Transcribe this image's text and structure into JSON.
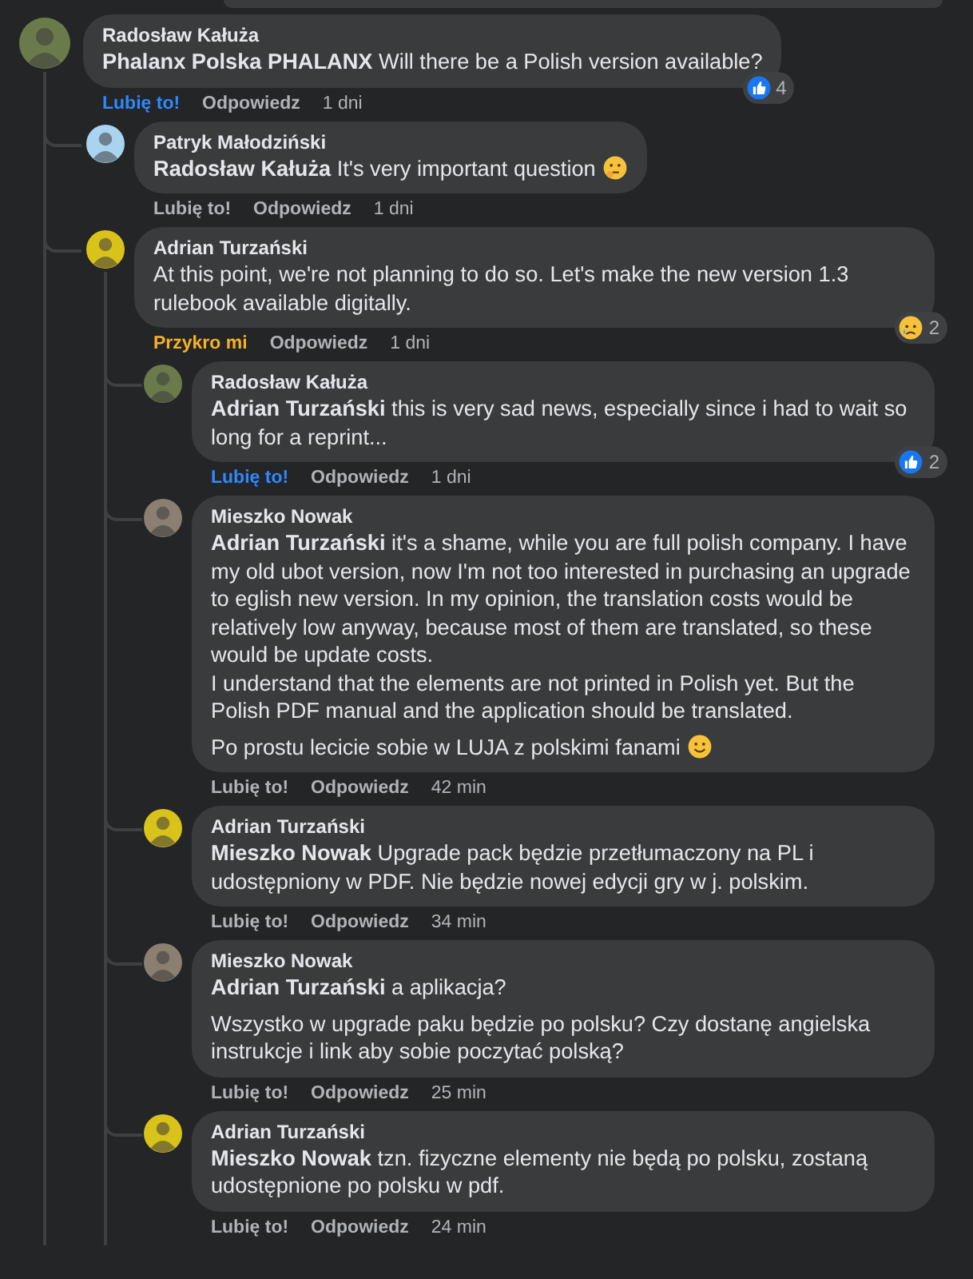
{
  "comments": [
    {
      "author": "Radosław Kałuża",
      "color": "#6b7a4a",
      "paragraphs": [
        {
          "text": "**Phalanx Polska PHALANX** Will there be a Polish version available?"
        }
      ],
      "reaction": {
        "kind": "like",
        "label": "Lubię to!"
      },
      "reply": "Odpowiedz",
      "time": "1 dni",
      "badge": {
        "kind": "like",
        "count": "4"
      },
      "children": [
        {
          "author": "Patryk Małodziński",
          "color": "#a9d4f0",
          "paragraphs": [
            {
              "text": "**Radosław Kałuża** It's very important question",
              "trailing_icon": {
                "kind": "thinking"
              }
            }
          ],
          "reaction": {
            "kind": "none",
            "label": "Lubię to!"
          },
          "reply": "Odpowiedz",
          "time": "1 dni"
        },
        {
          "author": "Adrian Turzański",
          "color": "#d9c21a",
          "paragraphs": [
            {
              "text": "At this point, we're not planning to do so. Let's make the new version 1.3 rulebook available digitally."
            }
          ],
          "reaction": {
            "kind": "sad",
            "label": "Przykro mi"
          },
          "reply": "Odpowiedz",
          "time": "1 dni",
          "badge": {
            "kind": "sad",
            "count": "2"
          },
          "children": [
            {
              "author": "Radosław Kałuża",
              "color": "#6b7a4a",
              "paragraphs": [
                {
                  "text": "**Adrian Turzański** this is very sad news, especially since i had to wait so long for a reprint..."
                }
              ],
              "reaction": {
                "kind": "like",
                "label": "Lubię to!"
              },
              "reply": "Odpowiedz",
              "time": "1 dni",
              "badge": {
                "kind": "like",
                "count": "2"
              }
            },
            {
              "author": "Mieszko Nowak",
              "color": "#8a7f70",
              "paragraphs": [
                {
                  "text": "**Adrian Turzański** it's a shame, while you are full polish company. I have my old ubot version, now I'm not too interested in purchasing an upgrade to eglish new version. In my opinion, the translation costs would be relatively low anyway, because most of them are translated, so these would be update costs.\nI understand that the elements are not printed in Polish yet. But the Polish PDF manual and the application should be translated."
                },
                {
                  "text": "Po prostu lecicie sobie w LUJA z polskimi fanami",
                  "trailing_icon": {
                    "kind": "smile"
                  }
                }
              ],
              "reaction": {
                "kind": "none",
                "label": "Lubię to!"
              },
              "reply": "Odpowiedz",
              "time": "42 min"
            },
            {
              "author": "Adrian Turzański",
              "color": "#d9c21a",
              "paragraphs": [
                {
                  "text": "**Mieszko Nowak** Upgrade pack będzie przetłumaczony na PL i udostępniony w PDF. Nie będzie nowej edycji gry w j. polskim."
                }
              ],
              "reaction": {
                "kind": "none",
                "label": "Lubię to!"
              },
              "reply": "Odpowiedz",
              "time": "34 min"
            },
            {
              "author": "Mieszko Nowak",
              "color": "#8a7f70",
              "paragraphs": [
                {
                  "text": "**Adrian Turzański** a aplikacja?"
                },
                {
                  "text": "Wszystko w upgrade paku będzie po polsku? Czy dostanę angielska instrukcje i link aby sobie poczytać polską?"
                }
              ],
              "reaction": {
                "kind": "none",
                "label": "Lubię to!"
              },
              "reply": "Odpowiedz",
              "time": "25 min"
            },
            {
              "author": "Adrian Turzański",
              "color": "#d9c21a",
              "paragraphs": [
                {
                  "text": "**Mieszko Nowak** tzn. fizyczne elementy nie będą po polsku, zostaną udostępnione po polsku w pdf."
                }
              ],
              "reaction": {
                "kind": "none",
                "label": "Lubię to!"
              },
              "reply": "Odpowiedz",
              "time": "24 min"
            }
          ]
        }
      ]
    }
  ]
}
